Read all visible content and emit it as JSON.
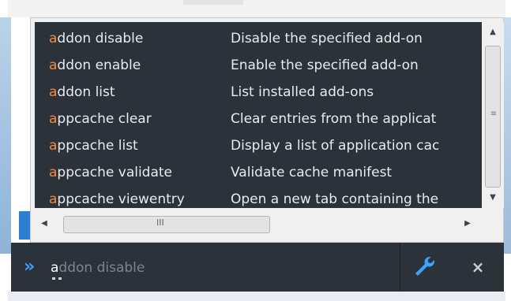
{
  "colors": {
    "panel_bg": "#2b3239",
    "text": "#e8ecef",
    "highlight": "#f48a3a",
    "accent_blue": "#3ea0ff",
    "placeholder": "#7b858f"
  },
  "suggestions": [
    {
      "match": "a",
      "rest": "ddon disable",
      "description": "Disable the specified add-on"
    },
    {
      "match": "a",
      "rest": "ddon enable",
      "description": "Enable the specified add-on"
    },
    {
      "match": "a",
      "rest": "ddon list",
      "description": "List installed add-ons"
    },
    {
      "match": "a",
      "rest": "ppcache clear",
      "description": "Clear entries from the applicat"
    },
    {
      "match": "a",
      "rest": "ppcache list",
      "description": "Display a list of application cac"
    },
    {
      "match": "a",
      "rest": "ppcache validate",
      "description": "Validate cache manifest"
    },
    {
      "match": "a",
      "rest": "ppcache viewentry",
      "description": "Open a new tab containing the"
    }
  ],
  "scrollbars": {
    "vertical": {
      "up_icon": "scroll-up-arrow-icon",
      "down_icon": "scroll-down-arrow-icon",
      "grip": "≡"
    },
    "horizontal": {
      "left_icon": "scroll-left-arrow-icon",
      "right_icon": "scroll-right-arrow-icon",
      "grip": "III"
    }
  },
  "command_line": {
    "prompt_icon": "double-chevron-right-icon",
    "prompt_glyph": "»",
    "typed": "a",
    "completion": "ddon disable",
    "settings_icon": "wrench-icon",
    "close_icon": "close-icon",
    "close_glyph": "×"
  }
}
